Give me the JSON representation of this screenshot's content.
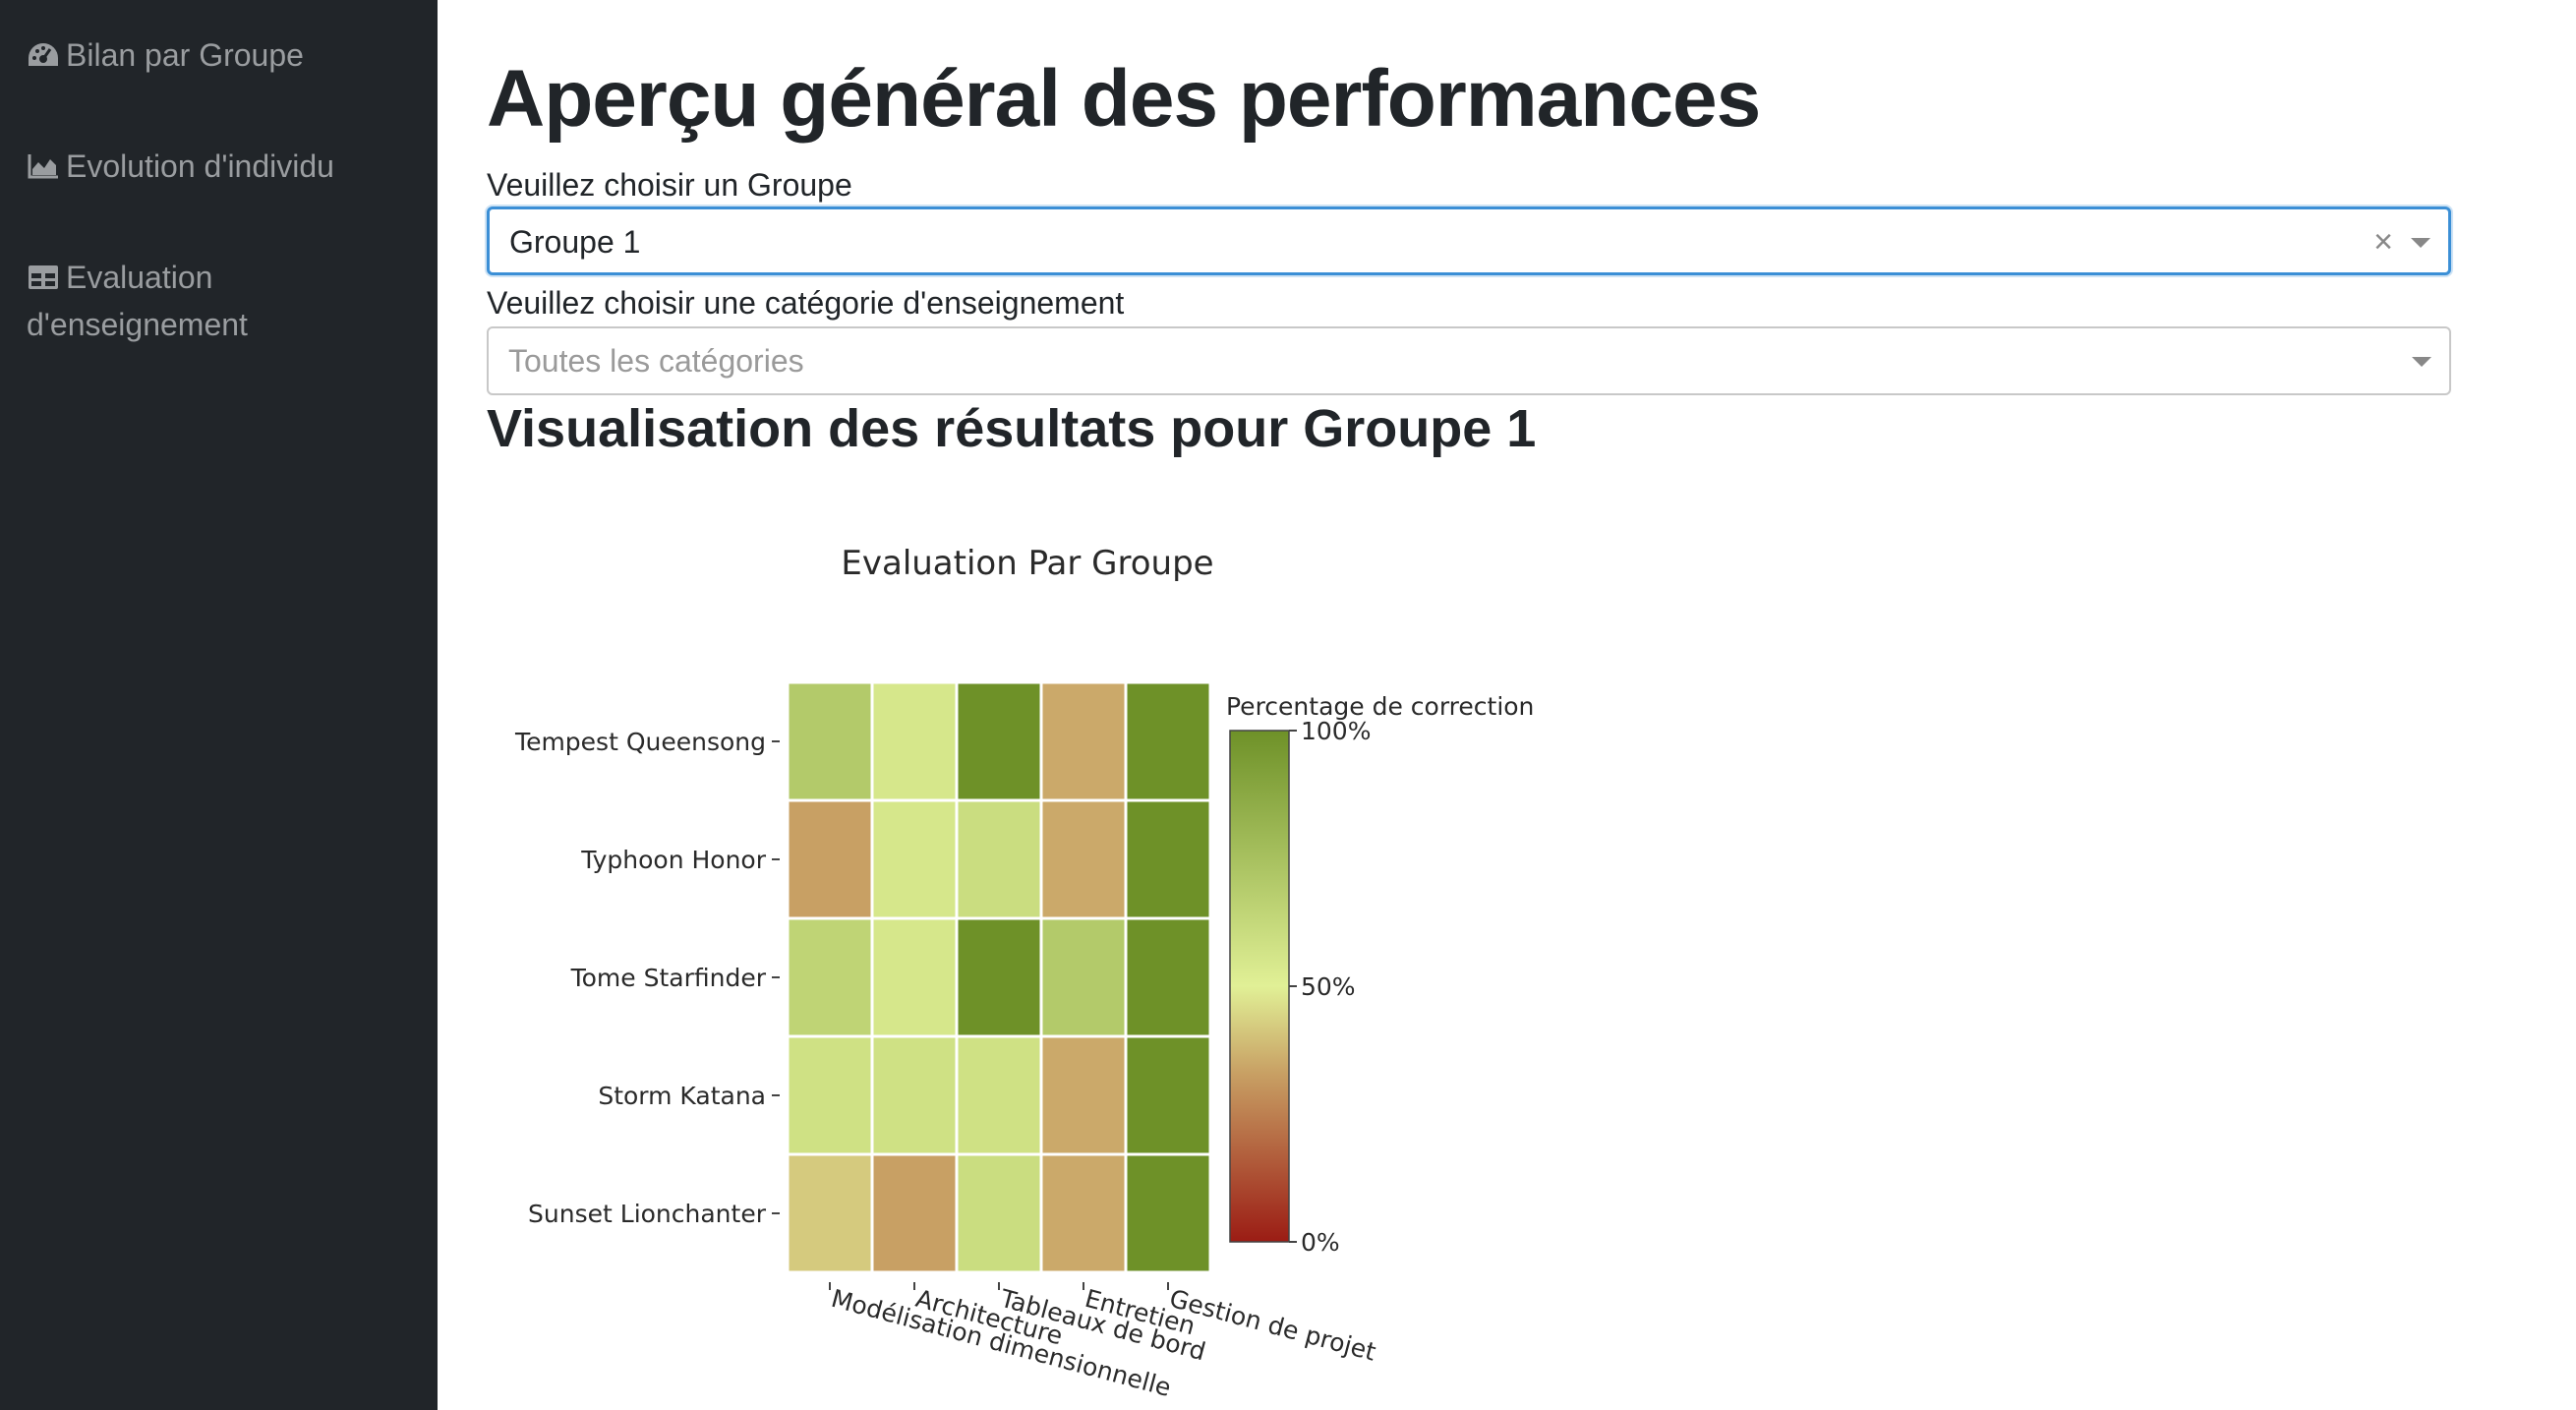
{
  "sidebar": {
    "items": [
      {
        "label": "Bilan par Groupe",
        "icon": "tachometer-icon"
      },
      {
        "label": "Evolution d'individu",
        "icon": "area-chart-icon"
      },
      {
        "label": "Evaluation",
        "label_line2": "d'enseignement",
        "icon": "table-icon"
      }
    ]
  },
  "main": {
    "title": "Aperçu général des performances",
    "group_select": {
      "label": "Veuillez choisir un Groupe",
      "value": "Groupe 1",
      "clear_symbol": "×"
    },
    "category_select": {
      "label": "Veuillez choisir une catégorie d'enseignement",
      "placeholder": "Toutes les catégories"
    },
    "section_title": "Visualisation des résultats pour Groupe 1"
  },
  "chart_data": {
    "type": "heatmap",
    "title": "Evaluation Par Groupe",
    "rows": [
      "Tempest Queensong",
      "Typhoon Honor",
      "Tome Starfinder",
      "Storm Katana",
      "Sunset Lionchanter"
    ],
    "columns": [
      "Modélisation dimensionnelle",
      "Architecture",
      "Tableaux de bord",
      "Entretien",
      "Gestion de projet"
    ],
    "values": [
      [
        70,
        55,
        100,
        35,
        100
      ],
      [
        33,
        55,
        60,
        35,
        100
      ],
      [
        65,
        55,
        100,
        70,
        100
      ],
      [
        58,
        58,
        58,
        35,
        100
      ],
      [
        42,
        33,
        60,
        35,
        100
      ]
    ],
    "colorbar": {
      "title": "Percentage de correction",
      "ticks": [
        "100%",
        "50%",
        "0%"
      ],
      "tick_values": [
        100,
        50,
        0
      ],
      "colorscale": [
        "#9b1c14",
        "#c8a064",
        "#e1f096",
        "#6e9128"
      ]
    }
  }
}
